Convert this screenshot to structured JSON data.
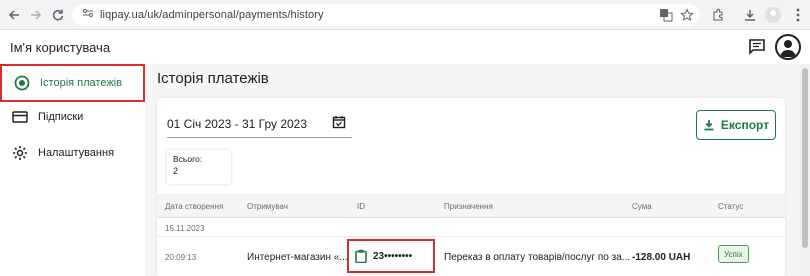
{
  "browser": {
    "url": "liqpay.ua/uk/adminpersonal/payments/history"
  },
  "header": {
    "username": "Ім'я користувача"
  },
  "sidebar": {
    "items": [
      {
        "label": "Історія платежів",
        "icon": "history-icon",
        "active": true
      },
      {
        "label": "Підписки",
        "icon": "subscriptions-icon",
        "active": false
      },
      {
        "label": "Налаштування",
        "icon": "gear-icon",
        "active": false
      }
    ]
  },
  "main": {
    "title": "Історія платежів",
    "date_range": "01 Січ 2023 - 31 Гру 2023",
    "export_label": "Експорт",
    "total": {
      "label": "Всього:",
      "value": "2"
    },
    "table": {
      "columns": [
        "Дата створення",
        "Отримувач",
        "ID",
        "Призначення",
        "Сума",
        "Статус"
      ],
      "group_date": "15.11.2023",
      "row": {
        "time": "20:09:13",
        "recipient": "Интернет-магазин «...",
        "id": "23••••••••",
        "purpose": "Переказ в оплату товарів/послуг по за...",
        "amount": "-128.00 UAH",
        "status": "Успіх"
      }
    }
  },
  "colors": {
    "accent": "#1f7a4a",
    "highlight": "#d32f2f",
    "success": "#43a047"
  }
}
